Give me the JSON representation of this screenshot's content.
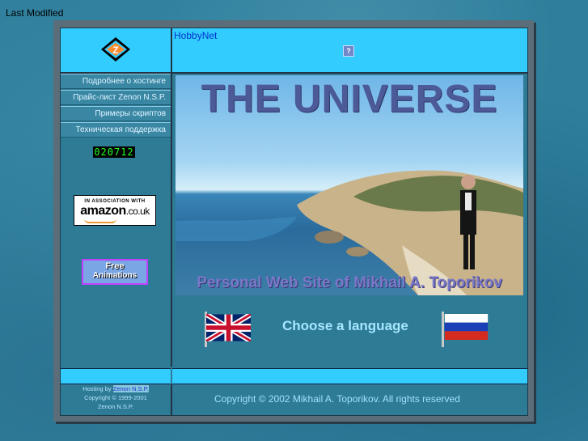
{
  "page": {
    "last_modified_label": "Last Modified"
  },
  "header": {
    "logo_icon": "zenon-logo-icon",
    "hobby_title": "HobbyNet",
    "help_label": "?"
  },
  "sidebar": {
    "items": [
      {
        "label": "Подробнее о хостинге"
      },
      {
        "label": "Прайс-лист Zenon N.S.P."
      },
      {
        "label": "Примеры скриптов"
      },
      {
        "label": "Техническая поддержка"
      }
    ],
    "counter": "020712",
    "amazon": {
      "assoc": "IN ASSOCIATION WITH",
      "brand": "amazon",
      "suffix": ".co.uk"
    },
    "free_animations": {
      "line1": "Free",
      "line2": "Animations"
    }
  },
  "hero": {
    "title": "THE UNIVERSE",
    "subtitle": "Personal Web Site of Mikhail A. Toporikov"
  },
  "language": {
    "prompt": "Choose a language",
    "english_flag": "uk-flag-icon",
    "russian_flag": "russia-flag-icon"
  },
  "footer": {
    "hosting_prefix": "Hosting by",
    "hosting_name": "Zenon N.S.P.",
    "copyright_left": "Copyright © 1999-2001",
    "company": "Zenon N.S.P.",
    "copyright_right": "Copyright © 2002 Mikhail A. Toporikov. All rights reserved"
  },
  "colors": {
    "accent": "#33ccff",
    "frame": "#2e7b96",
    "outer": "#5a6d78"
  }
}
